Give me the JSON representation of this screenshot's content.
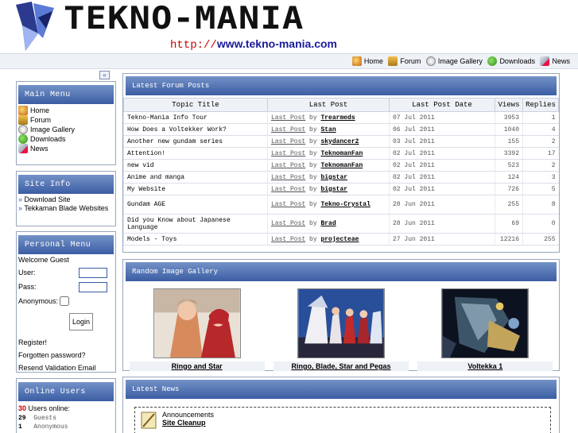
{
  "header": {
    "logo_text": "TEKNO-MANIA",
    "url_prefix": "http://",
    "url_domain": "www.tekno-mania.com"
  },
  "topnav": [
    {
      "label": "Home",
      "icon": "home-icon"
    },
    {
      "label": "Forum",
      "icon": "forum-icon"
    },
    {
      "label": "Image Gallery",
      "icon": "gallery-icon"
    },
    {
      "label": "Downloads",
      "icon": "downloads-icon"
    },
    {
      "label": "News",
      "icon": "news-icon"
    }
  ],
  "collapse_label": "«",
  "main_menu": {
    "title": "Main Menu",
    "items": [
      "Home",
      "Forum",
      "Image Gallery",
      "Downloads",
      "News"
    ]
  },
  "site_info": {
    "title": "Site Info",
    "links": [
      "Download Site",
      "Tekkaman Blade Websites"
    ],
    "bullet": "»"
  },
  "personal_menu": {
    "title": "Personal Menu",
    "welcome": "Welcome Guest",
    "user_label": "User:",
    "pass_label": "Pass:",
    "anon_label": "Anonymous:",
    "login_label": "Login",
    "links": [
      "Register!",
      "Forgotten password?",
      "Resend Validation Email"
    ]
  },
  "online_users": {
    "title": "Online Users",
    "count": "30",
    "count_label": "Users online:",
    "rows": [
      {
        "n": "29",
        "label": "Guests"
      },
      {
        "n": "1",
        "label": "Anonymous"
      }
    ]
  },
  "forum": {
    "title": "Latest Forum Posts",
    "columns": [
      "Topic Title",
      "Last Post",
      "Last Post Date",
      "Views",
      "Replies"
    ],
    "last_post_text": "Last Post",
    "by_text": "by",
    "rows": [
      {
        "topic": "Tekno-Mania Info Tour",
        "author": "Trearmeds",
        "date": "07 Jul 2011",
        "views": "3953",
        "replies": "1"
      },
      {
        "topic": "How Does a Voltekker Work?",
        "author": "Stan",
        "date": "06 Jul 2011",
        "views": "1040",
        "replies": "4"
      },
      {
        "topic": "Another new gundam series",
        "author": "skydancer2",
        "date": "03 Jul 2011",
        "views": "155",
        "replies": "2"
      },
      {
        "topic": "Attention!",
        "author": "TeknomanFan",
        "date": "02 Jul 2011",
        "views": "3392",
        "replies": "17"
      },
      {
        "topic": "new vid",
        "author": "TeknomanFan",
        "date": "02 Jul 2011",
        "views": "523",
        "replies": "2"
      },
      {
        "topic": "Anime and manga",
        "author": "bigstar",
        "date": "02 Jul 2011",
        "views": "124",
        "replies": "3"
      },
      {
        "topic": "My Website",
        "author": "bigstar",
        "date": "02 Jul 2011",
        "views": "726",
        "replies": "5"
      },
      {
        "topic": "Gundam AGE",
        "author": "Tekno-Crystal",
        "date": "28 Jun 2011",
        "views": "255",
        "replies": "8"
      },
      {
        "topic": "Did you Know about Japanese Language",
        "author": "Brad",
        "date": "28 Jun 2011",
        "views": "69",
        "replies": "0"
      },
      {
        "topic": "Models - Toys",
        "author": "projecteae",
        "date": "27 Jun 2011",
        "views": "12216",
        "replies": "255"
      }
    ]
  },
  "gallery": {
    "title": "Random Image Gallery",
    "images": [
      {
        "caption": "Ringo and Star"
      },
      {
        "caption": "Ringo, Blade, Star and Pegas"
      },
      {
        "caption": "Voltekka 1"
      }
    ]
  },
  "news": {
    "title": "Latest News",
    "category": "Announcements",
    "headline": "Site Cleanup"
  }
}
